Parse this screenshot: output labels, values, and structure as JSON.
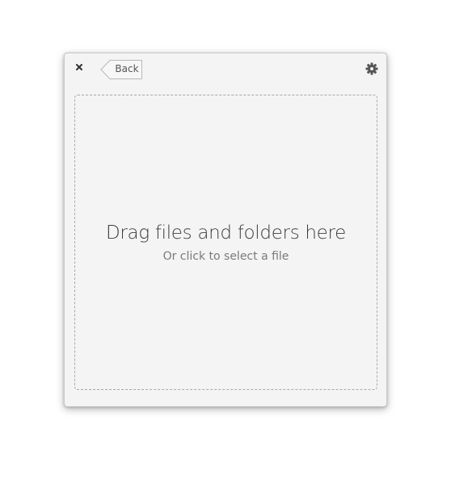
{
  "header": {
    "close_icon": "close-icon",
    "back_label": "Back",
    "settings_icon": "gear-icon"
  },
  "dropzone": {
    "title": "Drag files and folders here",
    "subtitle": "Or click to select a file"
  },
  "colors": {
    "window_bg": "#f4f4f4",
    "border_dashed": "#a9a9a9",
    "text_primary": "#3d3d3d",
    "text_secondary": "#7a7a7a"
  }
}
